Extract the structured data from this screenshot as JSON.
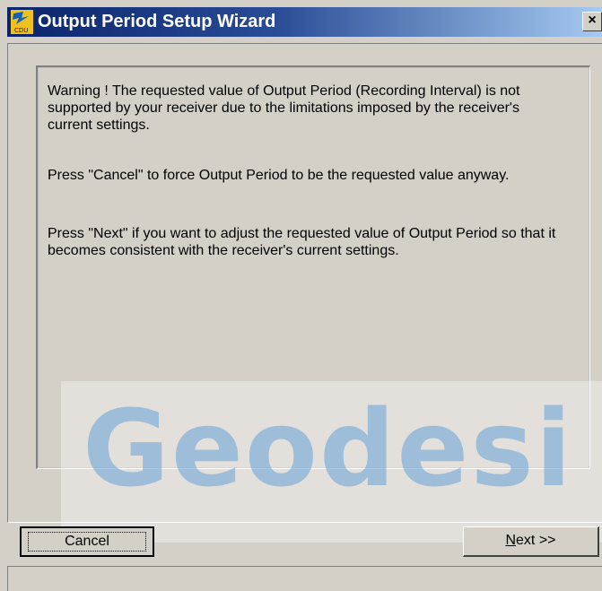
{
  "window": {
    "title": "Output Period Setup Wizard",
    "close_label": "×",
    "icon": "cdu-app-icon"
  },
  "message": {
    "paragraph1": "Warning ! The requested value of Output Period (Recording Interval) is not supported by your receiver due to the limitations imposed by the receiver's current settings.",
    "paragraph2": "Press \"Cancel\" to force Output Period to be the requested value anyway.",
    "paragraph3": "Press \"Next\" if you want to adjust the requested value of Output Period so that it becomes consistent with the receiver's current settings."
  },
  "watermark": {
    "text": "Geodesi"
  },
  "buttons": {
    "cancel_label": "Cancel",
    "next_accel": "N",
    "next_rest": "ext >>"
  },
  "colors": {
    "titlebar_start": "#0a246a",
    "titlebar_end": "#a6caf0",
    "face": "#d4d0c8"
  }
}
